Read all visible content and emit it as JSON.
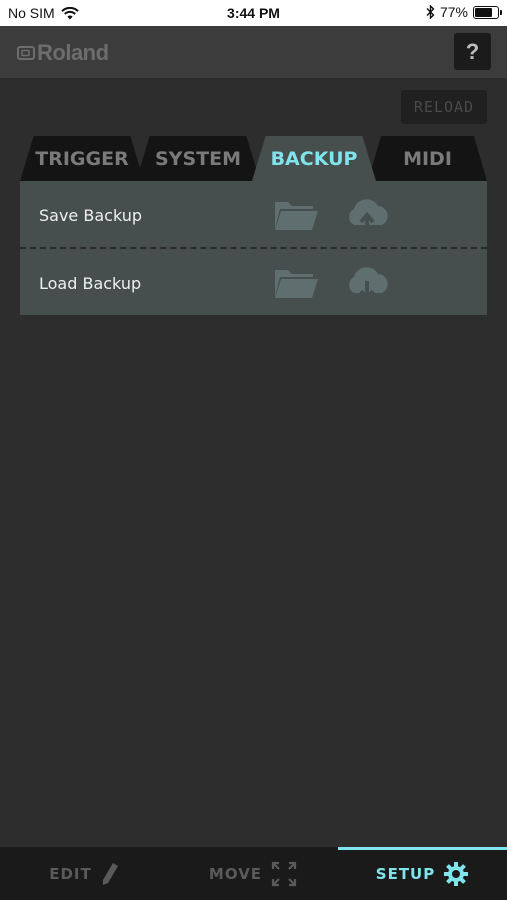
{
  "status_bar": {
    "carrier": "No SIM",
    "time": "3:44 PM",
    "battery_percent": "77%",
    "battery_level": 0.77
  },
  "header": {
    "brand": "Roland",
    "help_label": "?"
  },
  "reload_label": "RELOAD",
  "tabs": [
    {
      "label": "TRIGGER",
      "active": false
    },
    {
      "label": "SYSTEM",
      "active": false
    },
    {
      "label": "BACKUP",
      "active": true
    },
    {
      "label": "MIDI",
      "active": false
    }
  ],
  "backup_rows": [
    {
      "label": "Save Backup",
      "icons": [
        "folder-icon",
        "cloud-upload-icon"
      ]
    },
    {
      "label": "Load Backup",
      "icons": [
        "folder-icon",
        "cloud-download-icon"
      ]
    }
  ],
  "bottom_nav": [
    {
      "label": "EDIT",
      "icon": "pencil-icon",
      "active": false
    },
    {
      "label": "MOVE",
      "icon": "expand-icon",
      "active": false
    },
    {
      "label": "SETUP",
      "icon": "gear-icon",
      "active": true
    }
  ],
  "colors": {
    "accent": "#7fe4ec",
    "background": "#2d2d2d",
    "panel": "#474e4e",
    "icon_muted": "#5f6f6f"
  }
}
